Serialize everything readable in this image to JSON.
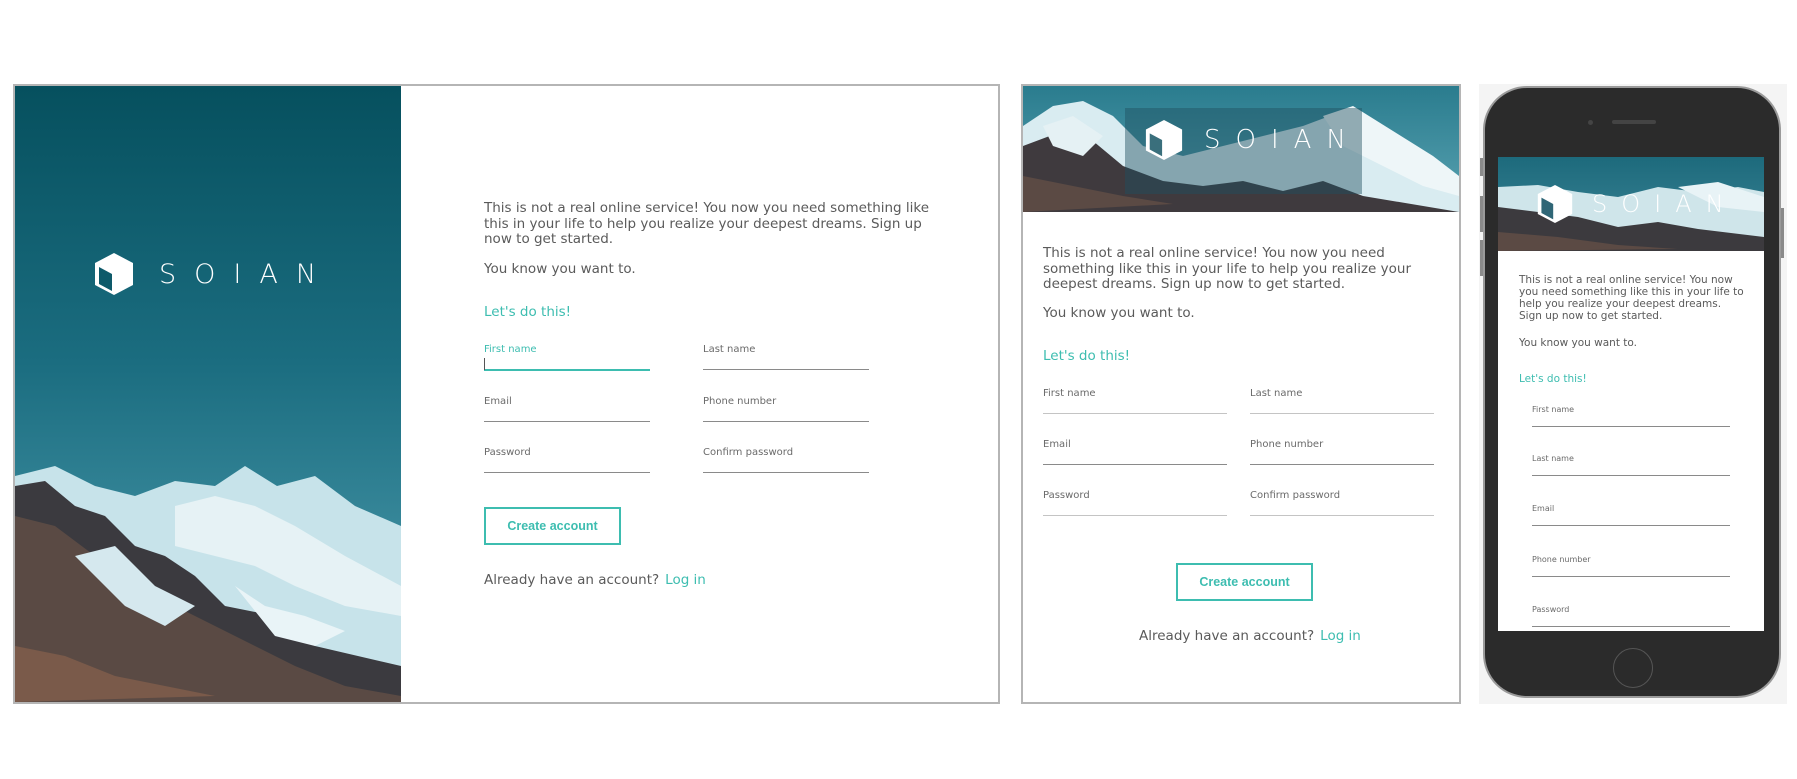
{
  "brand": {
    "name": "SOIAN",
    "logo_icon": "cube-icon"
  },
  "colors": {
    "accent": "#3dbdb0",
    "dark_teal": "#0a4a5a",
    "text": "#5a5a5a"
  },
  "signup": {
    "intro": "This is not a real online service! You now you need something like this in your life to help you realize your deepest dreams. Sign up now to get started.",
    "intro2": "You know you want to.",
    "cta": "Let's do this!",
    "fields": {
      "first_name": "First name",
      "last_name": "Last name",
      "email": "Email",
      "phone": "Phone number",
      "password": "Password",
      "confirm_password": "Confirm password"
    },
    "create_button": "Create account",
    "login_prompt": "Already have an account?",
    "login_link": "Log in"
  }
}
